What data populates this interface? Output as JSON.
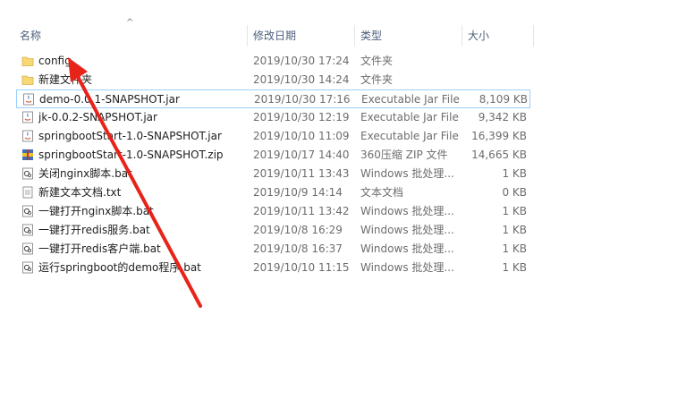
{
  "header": {
    "columns": {
      "name": "名称",
      "date": "修改日期",
      "type": "类型",
      "size": "大小"
    },
    "sort_indicator": "^"
  },
  "files": [
    {
      "name": "config",
      "date": "2019/10/30 17:24",
      "type": "文件夹",
      "size": "",
      "icon": "folder-icon"
    },
    {
      "name": "新建文件夹",
      "date": "2019/10/30 14:24",
      "type": "文件夹",
      "size": "",
      "icon": "folder-icon"
    },
    {
      "name": "demo-0.0.1-SNAPSHOT.jar",
      "date": "2019/10/30 17:16",
      "type": "Executable Jar File",
      "size": "8,109 KB",
      "icon": "jar-icon"
    },
    {
      "name": "jk-0.0.2-SNAPSHOT.jar",
      "date": "2019/10/30 12:19",
      "type": "Executable Jar File",
      "size": "9,342 KB",
      "icon": "jar-icon"
    },
    {
      "name": "springbootStart-1.0-SNAPSHOT.jar",
      "date": "2019/10/10 11:09",
      "type": "Executable Jar File",
      "size": "16,399 KB",
      "icon": "jar-icon"
    },
    {
      "name": "springbootStart-1.0-SNAPSHOT.zip",
      "date": "2019/10/17 14:40",
      "type": "360压缩 ZIP 文件",
      "size": "14,665 KB",
      "icon": "zip-icon"
    },
    {
      "name": "关闭nginx脚本.bat",
      "date": "2019/10/11 13:43",
      "type": "Windows 批处理...",
      "size": "1 KB",
      "icon": "bat-icon"
    },
    {
      "name": "新建文本文档.txt",
      "date": "2019/10/9 14:14",
      "type": "文本文档",
      "size": "0 KB",
      "icon": "txt-icon"
    },
    {
      "name": "一键打开nginx脚本.bat",
      "date": "2019/10/11 13:42",
      "type": "Windows 批处理...",
      "size": "1 KB",
      "icon": "bat-icon"
    },
    {
      "name": "一键打开redis服务.bat",
      "date": "2019/10/8 16:29",
      "type": "Windows 批处理...",
      "size": "1 KB",
      "icon": "bat-icon"
    },
    {
      "name": "一键打开redis客户端.bat",
      "date": "2019/10/8 16:37",
      "type": "Windows 批处理...",
      "size": "1 KB",
      "icon": "bat-icon"
    },
    {
      "name": "运行springboot的demo程序.bat",
      "date": "2019/10/10 11:15",
      "type": "Windows 批处理...",
      "size": "1 KB",
      "icon": "bat-icon"
    }
  ],
  "colors": {
    "selection_border": "#99d1ff",
    "annotation_arrow": "#e8231a",
    "folder_yellow": "#f8d775"
  }
}
